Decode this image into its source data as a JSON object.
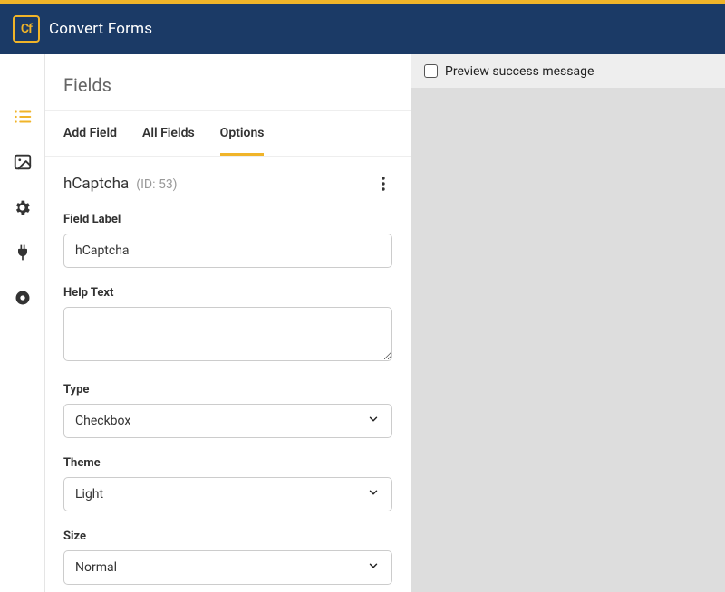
{
  "brand": {
    "logo_text": "Cf",
    "name": "Convert Forms"
  },
  "panel": {
    "title": "Fields",
    "tabs": [
      {
        "label": "Add Field"
      },
      {
        "label": "All Fields"
      },
      {
        "label": "Options"
      }
    ],
    "section": {
      "name": "hCaptcha",
      "id_label": "(ID: 53)"
    },
    "fields": {
      "field_label": {
        "label": "Field Label",
        "value": "hCaptcha"
      },
      "help_text": {
        "label": "Help Text",
        "value": ""
      },
      "type": {
        "label": "Type",
        "value": "Checkbox"
      },
      "theme": {
        "label": "Theme",
        "value": "Light"
      },
      "size": {
        "label": "Size",
        "value": "Normal"
      }
    }
  },
  "preview": {
    "checkbox_label": "Preview success message"
  }
}
